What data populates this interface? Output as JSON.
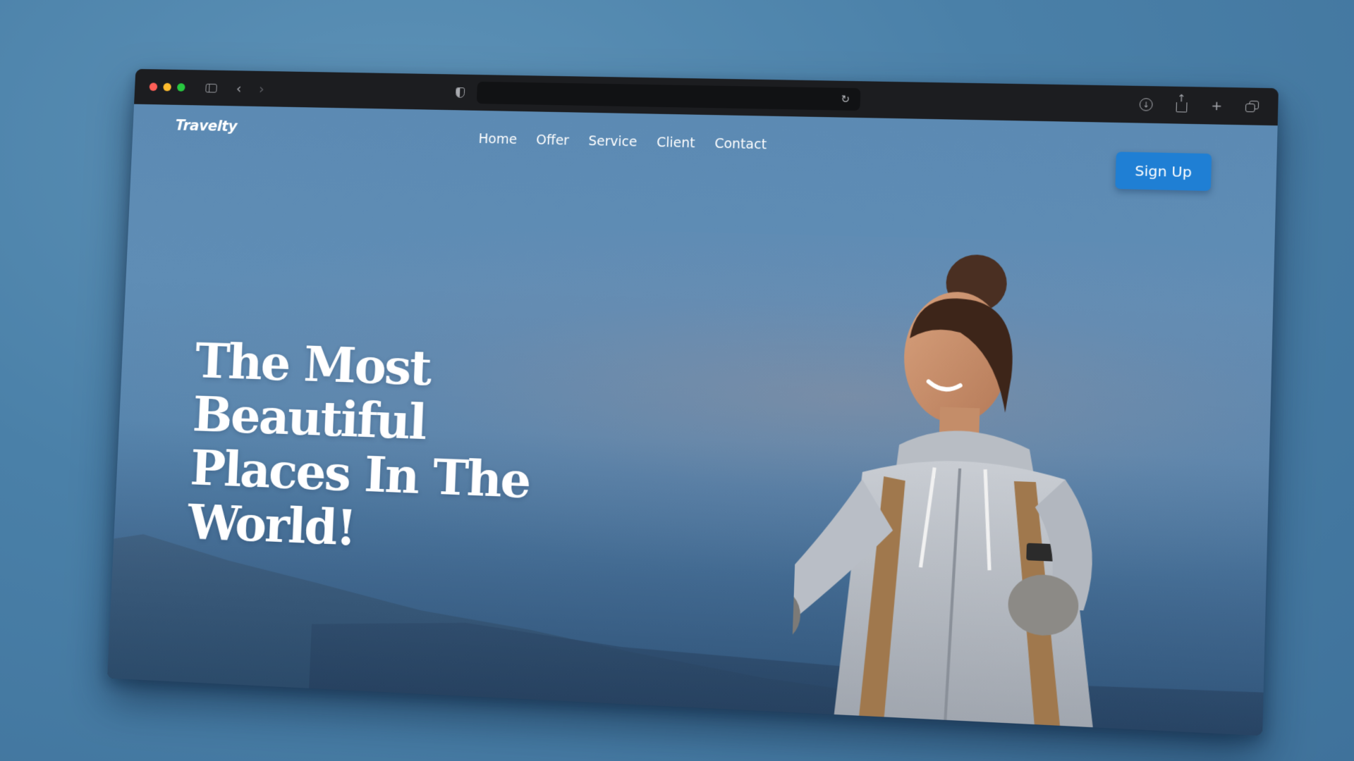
{
  "browser": {
    "url_value": "",
    "icons": {
      "sidebar": "sidebar-toggle-icon",
      "back": "chevron-left-icon",
      "forward": "chevron-right-icon",
      "privacy": "shield-icon",
      "reload": "reload-icon",
      "download": "download-icon",
      "share": "share-icon",
      "new_tab": "plus-icon",
      "tab_overview": "tabs-icon"
    },
    "glyphs": {
      "back": "‹",
      "forward": "›",
      "reload": "↻",
      "download": "↓",
      "new_tab": "+"
    }
  },
  "site": {
    "logo": "Travelty",
    "nav": [
      {
        "label": "Home"
      },
      {
        "label": "Offer"
      },
      {
        "label": "Service"
      },
      {
        "label": "Client"
      },
      {
        "label": "Contact"
      }
    ],
    "signup_label": "Sign Up",
    "hero": {
      "line1": "The Most Beautiful",
      "line2": "Places In The",
      "line3": "World!"
    }
  },
  "colors": {
    "accent": "#1f7fd4",
    "traffic_red": "#ff5f57",
    "traffic_yellow": "#febc2e",
    "traffic_green": "#28c840",
    "desktop_bg": "#4a80a8",
    "sky": "#5c8ab3"
  }
}
